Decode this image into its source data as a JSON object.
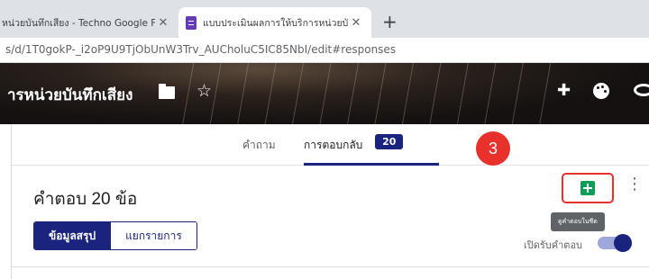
{
  "browser": {
    "tabs": [
      {
        "title": "หน่วยบันทึกเสียง - Techno Google F",
        "close": "✕"
      },
      {
        "title": "แบบประเมินผลการให้บริการหน่วยบันทึก",
        "close": "✕"
      }
    ],
    "new_tab": "+",
    "url": "s/d/1T0gokP-_i2oP9U9TjObUnW3Trv_AUCholuC5IC85NbI/edit#responses"
  },
  "form_header": {
    "title": "ารหน่วยบันทึกเสียง",
    "icons": [
      "folder-icon",
      "star-icon",
      "addon-icon",
      "palette-icon",
      "preview-icon"
    ],
    "star_glyph": "☆"
  },
  "form_tabs": {
    "questions": "คำถาม",
    "responses": "การตอบกลับ",
    "response_count": "20"
  },
  "step_marker": "3",
  "responses": {
    "heading": "คำตอบ 20 ข้อ",
    "summary_button": "ข้อมูลสรุป",
    "individual_button": "แยกรายการ",
    "sheets_tooltip": "ดูคำตอบในชีต",
    "accepting_label": "เปิดรับคำตอบ",
    "accepting": true
  },
  "colors": {
    "accent": "#1a237e",
    "highlight": "#e8312b",
    "sheets_green": "#0f9d58"
  }
}
